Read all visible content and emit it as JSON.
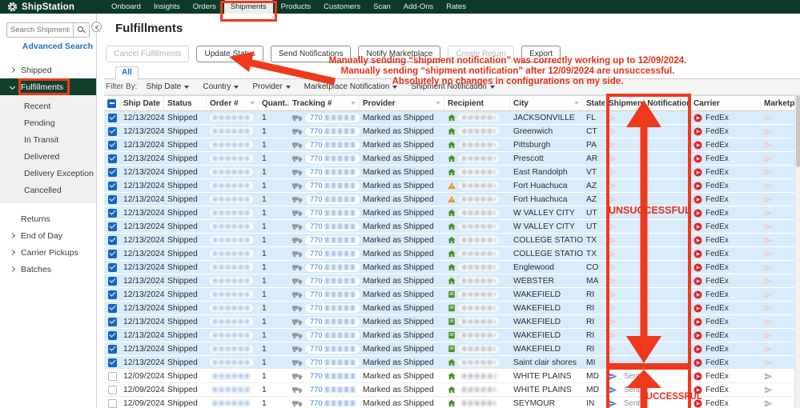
{
  "navbar": {
    "brand": "ShipStation",
    "items": [
      {
        "label": "Onboard"
      },
      {
        "label": "Insights"
      },
      {
        "label": "Orders"
      },
      {
        "label": "Shipments",
        "active": true,
        "annotated": true
      },
      {
        "label": "Products"
      },
      {
        "label": "Customers"
      },
      {
        "label": "Scan"
      },
      {
        "label": "Add-Ons"
      },
      {
        "label": "Rates"
      }
    ]
  },
  "sidebar": {
    "search_placeholder": "Search Shipments...",
    "advanced_search": "Advanced Search",
    "items": [
      {
        "label": "Shipped",
        "chevron": "right"
      },
      {
        "label": "Fulfillments",
        "chevron": "down",
        "active": true,
        "annotated": true
      },
      {
        "label": "Recent",
        "sub": true
      },
      {
        "label": "Pending",
        "sub": true
      },
      {
        "label": "In Transit",
        "sub": true
      },
      {
        "label": "Delivered",
        "sub": true
      },
      {
        "label": "Delivery Exception",
        "sub": true
      },
      {
        "label": "Cancelled",
        "sub": true
      },
      {
        "label": "Returns",
        "chevron": "none",
        "gap": true
      },
      {
        "label": "End of Day",
        "chevron": "right"
      },
      {
        "label": "Carrier Pickups",
        "chevron": "right"
      },
      {
        "label": "Batches",
        "chevron": "right"
      }
    ]
  },
  "page": {
    "title": "Fulfillments"
  },
  "toolbar": {
    "buttons": [
      {
        "label": "Cancel Fulfillments",
        "disabled": true
      },
      {
        "label": "Update Status",
        "disabled": false
      },
      {
        "label": "Send Notifications",
        "disabled": false
      },
      {
        "label": "Notify Marketplace",
        "disabled": false
      },
      {
        "label": "Create Return",
        "disabled": true
      },
      {
        "label": "Export",
        "disabled": false
      }
    ]
  },
  "tabs": [
    "All"
  ],
  "filters": {
    "label": "Filter By:",
    "dropdowns": [
      "Ship Date",
      "Country",
      "Provider",
      "Marketplace Notification",
      "Shipment Notification"
    ]
  },
  "table": {
    "columns": [
      "",
      "Ship Date",
      "Status",
      "Order #",
      "Quant...",
      "Tracking #",
      "Provider",
      "Recipient",
      "City",
      "State",
      "Shipment Notification",
      "Carrier",
      "Marketplace"
    ],
    "row_defaults": {
      "status": "Shipped",
      "quantity": "1",
      "tracking_prefix": "770",
      "provider": "Marked as Shipped",
      "carrier": "FedEx",
      "sent_label": "Sent"
    },
    "rows": [
      {
        "date": "12/13/2024",
        "city": "JACKSONVILLE",
        "state": "FL",
        "recipient_icon": "house",
        "checked": true,
        "notification": "none"
      },
      {
        "date": "12/13/2024",
        "city": "Greenwich",
        "state": "CT",
        "recipient_icon": "house",
        "checked": true,
        "notification": "none"
      },
      {
        "date": "12/13/2024",
        "city": "Pittsburgh",
        "state": "PA",
        "recipient_icon": "house",
        "checked": true,
        "notification": "none"
      },
      {
        "date": "12/13/2024",
        "city": "Prescott",
        "state": "AR",
        "recipient_icon": "house",
        "checked": true,
        "notification": "none"
      },
      {
        "date": "12/13/2024",
        "city": "East Randolph",
        "state": "VT",
        "recipient_icon": "house",
        "checked": true,
        "notification": "none"
      },
      {
        "date": "12/13/2024",
        "city": "Fort Huachuca",
        "state": "AZ",
        "recipient_icon": "warning",
        "checked": true,
        "notification": "none"
      },
      {
        "date": "12/13/2024",
        "city": "Fort Huachuca",
        "state": "AZ",
        "recipient_icon": "warning",
        "checked": true,
        "notification": "none"
      },
      {
        "date": "12/13/2024",
        "city": "W VALLEY CITY",
        "state": "UT",
        "recipient_icon": "house",
        "checked": true,
        "notification": "none"
      },
      {
        "date": "12/13/2024",
        "city": "W VALLEY CITY",
        "state": "UT",
        "recipient_icon": "house",
        "checked": true,
        "notification": "none"
      },
      {
        "date": "12/13/2024",
        "city": "COLLEGE STATION",
        "state": "TX",
        "recipient_icon": "house",
        "checked": true,
        "notification": "none"
      },
      {
        "date": "12/13/2024",
        "city": "COLLEGE STATION",
        "state": "TX",
        "recipient_icon": "house",
        "checked": true,
        "notification": "none"
      },
      {
        "date": "12/13/2024",
        "city": "Englewood",
        "state": "CO",
        "recipient_icon": "house",
        "checked": true,
        "notification": "none"
      },
      {
        "date": "12/13/2024",
        "city": "WEBSTER",
        "state": "MA",
        "recipient_icon": "house",
        "checked": true,
        "notification": "none"
      },
      {
        "date": "12/13/2024",
        "city": "WAKEFIELD",
        "state": "RI",
        "recipient_icon": "business",
        "checked": true,
        "notification": "none"
      },
      {
        "date": "12/13/2024",
        "city": "WAKEFIELD",
        "state": "RI",
        "recipient_icon": "business",
        "checked": true,
        "notification": "none"
      },
      {
        "date": "12/13/2024",
        "city": "WAKEFIELD",
        "state": "RI",
        "recipient_icon": "business",
        "checked": true,
        "notification": "none"
      },
      {
        "date": "12/13/2024",
        "city": "WAKEFIELD",
        "state": "RI",
        "recipient_icon": "business",
        "checked": true,
        "notification": "none"
      },
      {
        "date": "12/13/2024",
        "city": "WAKEFIELD",
        "state": "RI",
        "recipient_icon": "business",
        "checked": true,
        "notification": "none"
      },
      {
        "date": "12/13/2024",
        "city": "Saint clair shores",
        "state": "MI",
        "recipient_icon": "house",
        "checked": true,
        "notification": "none"
      },
      {
        "date": "12/09/2024",
        "city": "WHITE PLAINS",
        "state": "MD",
        "recipient_icon": "house",
        "checked": false,
        "notification": "sent"
      },
      {
        "date": "12/09/2024",
        "city": "WHITE PLAINS",
        "state": "MD",
        "recipient_icon": "house",
        "checked": false,
        "notification": "sent"
      },
      {
        "date": "12/09/2024",
        "city": "SEYMOUR",
        "state": "IN",
        "recipient_icon": "house",
        "checked": false,
        "notification": "sent"
      }
    ]
  },
  "annotations": {
    "callout": [
      "Manually sending “shipment notification” was correctly working up to 12/09/2024.",
      "Manually sending “shipment notification” after 12/09/2024 are unsuccessful.",
      "Absolutely no changes in configurations on my side."
    ],
    "unsuccessful": "UNSUCCESSFUL",
    "successful": "SUCCESSFUL"
  },
  "colors": {
    "navbar_green": "#0c3a28",
    "sidebar_active_green": "#123f2c",
    "link_blue": "#1f71c2",
    "selected_row_blue": "#d9ecfb",
    "checkbox_blue": "#1565c0",
    "annotation_red": "#f0381c",
    "fedex_red": "#e1262d",
    "recipient_green": "#4a9122",
    "warning_orange": "#ef8c1a"
  }
}
